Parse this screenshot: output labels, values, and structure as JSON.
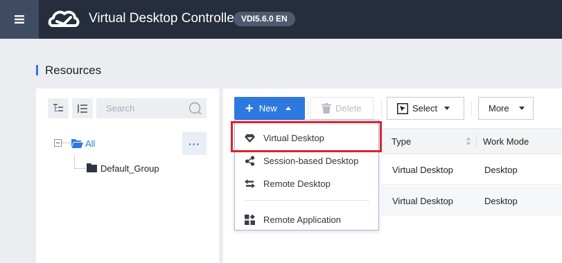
{
  "header": {
    "app_title": "Virtual Desktop Controller",
    "version": "VDI5.6.0 EN"
  },
  "page": {
    "title": "Resources"
  },
  "left_panel": {
    "search": {
      "placeholder": "Search",
      "value": ""
    },
    "tree": {
      "root_label": "All",
      "more_label": "···",
      "children": [
        {
          "label": "Default_Group"
        }
      ]
    }
  },
  "toolbar": {
    "new_label": "New",
    "delete_label": "Delete",
    "select_label": "Select",
    "more_label": "More"
  },
  "new_menu": {
    "items": [
      {
        "label": "Virtual Desktop",
        "icon": "gem-icon"
      },
      {
        "label": "Session-based Desktop",
        "icon": "share-nodes-icon"
      },
      {
        "label": "Remote Desktop",
        "icon": "swap-arrows-icon"
      },
      {
        "label": "Remote Application",
        "icon": "app-grid-icon"
      }
    ],
    "highlighted_item": "Virtual Desktop"
  },
  "table": {
    "columns": [
      "Type",
      "Work Mode"
    ],
    "rows": [
      [
        "Virtual Desktop",
        "Desktop"
      ],
      [
        "Virtual Desktop",
        "Desktop"
      ]
    ]
  },
  "colors": {
    "header_bg": "#262d3c",
    "menu_button_bg": "#3f4b62",
    "accent_blue": "#2d79e0",
    "highlight_red": "#e1202a",
    "page_bg": "#ebedf1"
  }
}
